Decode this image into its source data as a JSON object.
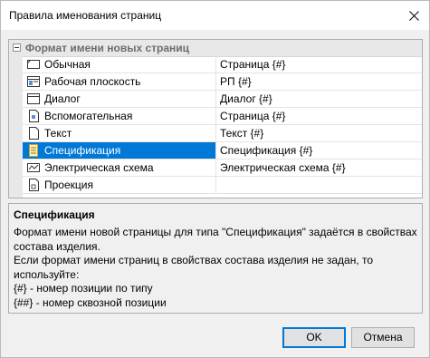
{
  "window": {
    "title": "Правила именования страниц",
    "close_label": "✕"
  },
  "grid": {
    "category": "Формат имени новых страниц",
    "rows": [
      {
        "name": "Обычная",
        "value": "Страница {#}",
        "icon": "page-icon"
      },
      {
        "name": "Рабочая плоскость",
        "value": "РП {#}",
        "icon": "workplane-icon"
      },
      {
        "name": "Диалог",
        "value": "Диалог {#}",
        "icon": "dialog-icon"
      },
      {
        "name": "Вспомогательная",
        "value": "Страница {#}",
        "icon": "aux-page-icon"
      },
      {
        "name": "Текст",
        "value": "Текст {#}",
        "icon": "text-page-icon"
      },
      {
        "name": "Спецификация",
        "value": "Спецификация {#}",
        "icon": "specification-icon",
        "selected": true
      },
      {
        "name": "Электрическая схема",
        "value": "Электрическая схема {#}",
        "icon": "electric-scheme-icon"
      },
      {
        "name": "Проекция",
        "value": "",
        "icon": "projection-icon"
      }
    ]
  },
  "description": {
    "title": "Спецификация",
    "lines": [
      "Формат имени новой страницы для типа \"Спецификация\" задаётся в свойствах",
      "состава изделия.",
      "Если формат имени страниц в свойствах состава изделия не задан, то",
      "используйте:",
      "{#} - номер позиции по типу",
      "{##} - номер сквозной позиции"
    ]
  },
  "buttons": {
    "ok": "OK",
    "cancel": "Отмена"
  },
  "colors": {
    "selection": "#0078d7",
    "category_bg": "#e8e8e8"
  }
}
